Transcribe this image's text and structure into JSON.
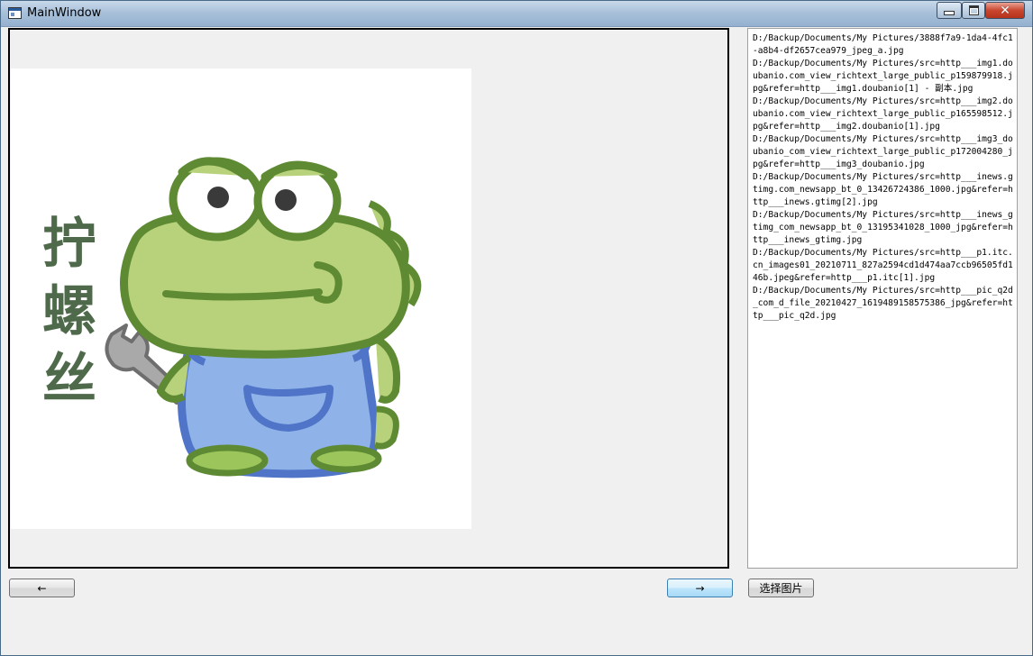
{
  "window": {
    "title": "MainWindow",
    "minimize_icon": "minimize-icon",
    "maximize_icon": "maximize-icon",
    "close_icon": "close-icon",
    "close_glyph": "✕"
  },
  "image_view": {
    "sticker_text": [
      "拧",
      "螺",
      "丝"
    ]
  },
  "file_list": {
    "items": [
      "D:/Backup/Documents/My Pictures/3888f7a9-1da4-4fc1-a8b4-df2657cea979_jpeg_a.jpg",
      "D:/Backup/Documents/My Pictures/src=http___img1.doubanio.com_view_richtext_large_public_p159879918.jpg&refer=http___img1.doubanio[1] - 副本.jpg",
      "D:/Backup/Documents/My Pictures/src=http___img2.doubanio.com_view_richtext_large_public_p165598512.jpg&refer=http___img2.doubanio[1].jpg",
      "D:/Backup/Documents/My Pictures/src=http___img3_doubanio_com_view_richtext_large_public_p172004280_jpg&refer=http___img3_doubanio.jpg",
      "D:/Backup/Documents/My Pictures/src=http___inews.gtimg.com_newsapp_bt_0_13426724386_1000.jpg&refer=http___inews.gtimg[2].jpg",
      "D:/Backup/Documents/My Pictures/src=http___inews_gtimg_com_newsapp_bt_0_13195341028_1000_jpg&refer=http___inews_gtimg.jpg",
      "D:/Backup/Documents/My Pictures/src=http___p1.itc.cn_images01_20210711_827a2594cd1d474aa7ccb96505fd146b.jpeg&refer=http___p1.itc[1].jpg",
      "D:/Backup/Documents/My Pictures/src=http___pic_q2d_com_d_file_20210427_1619489158575386_jpg&refer=http___pic_q2d.jpg"
    ]
  },
  "buttons": {
    "prev_label": "←",
    "next_label": "→",
    "select_label": "选择图片"
  }
}
